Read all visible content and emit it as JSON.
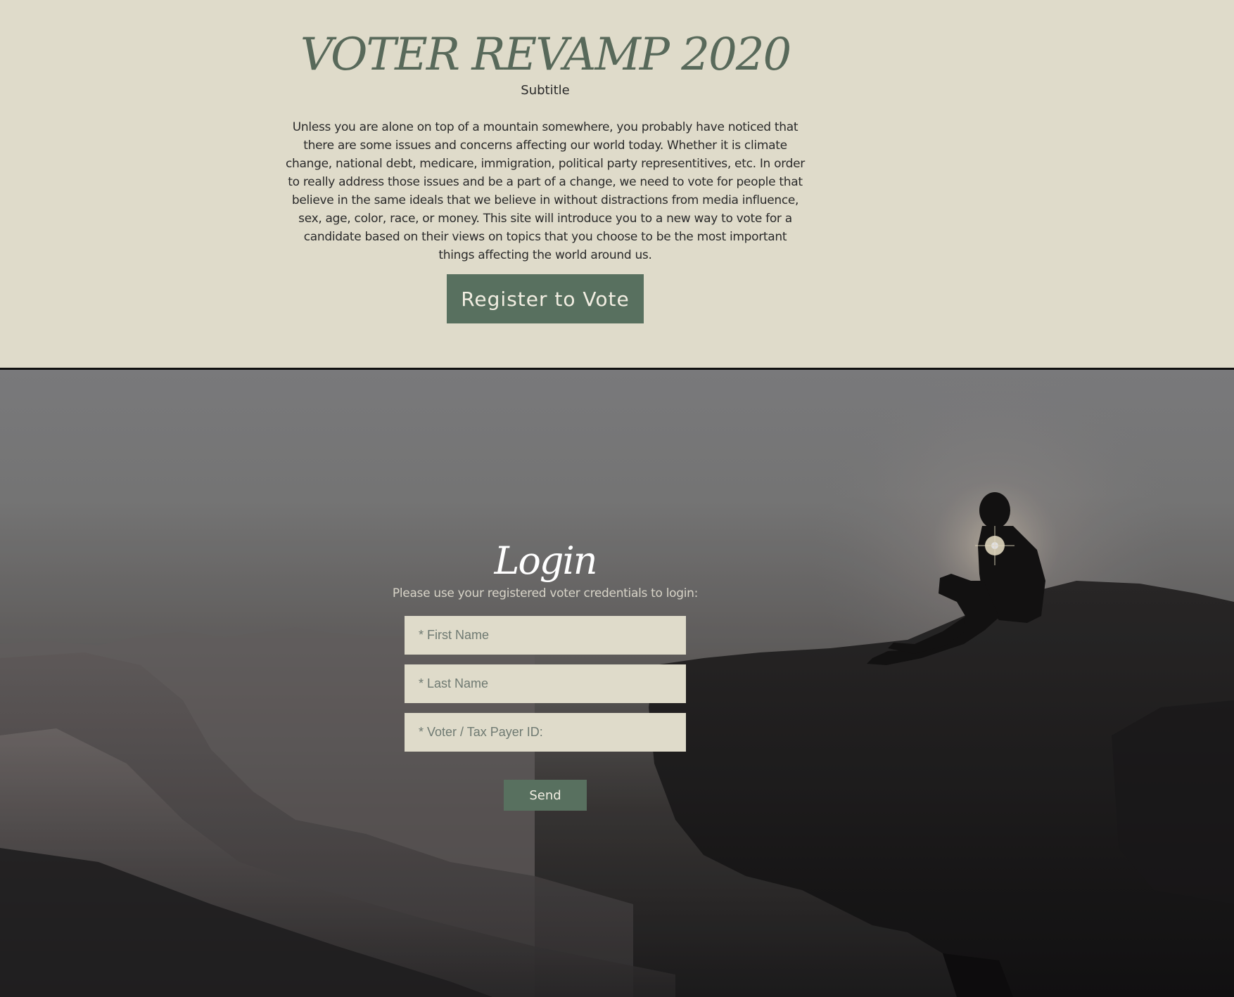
{
  "hero": {
    "title": "VOTER REVAMP 2020",
    "subtitle": "Subtitle",
    "intro": "Unless you are alone on top of a mountain somewhere, you probably have noticed that there are some issues and concerns affecting our world today. Whether it is climate change, national debt, medicare, immigration, political party representitives, etc. In order to really address those issues and be a part of a change, we need to vote for people that believe in the same ideals that we believe in without distractions from media influence, sex, age, color, race, or money. This site will introduce you to a new way to vote for a candidate based on their views on topics that you choose to be the most important things affecting the world around us.",
    "register_label": "Register to Vote"
  },
  "login": {
    "title": "Login",
    "note": "Please use your registered voter credentials to login:",
    "fields": {
      "first_name_placeholder": "* First Name",
      "last_name_placeholder": "* Last Name",
      "voter_id_placeholder": "* Voter / Tax Payer ID:"
    },
    "send_label": "Send"
  },
  "colors": {
    "background": "#dfdbca",
    "accent": "#58705f",
    "title": "#58695a"
  }
}
